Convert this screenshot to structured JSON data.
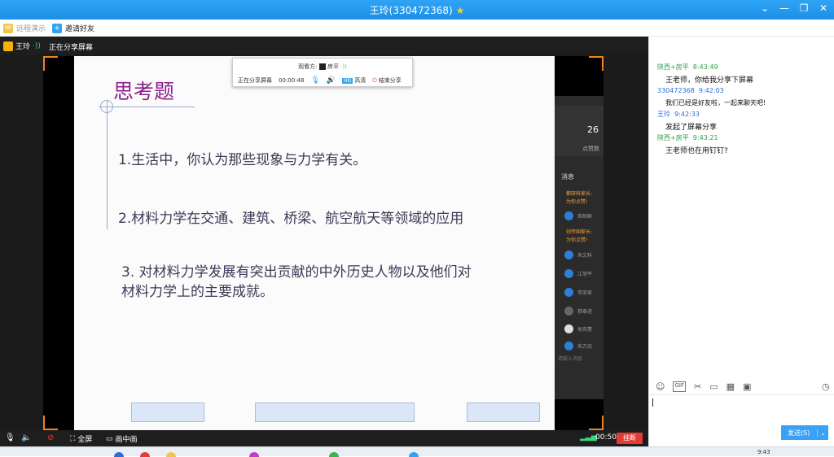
{
  "window": {
    "title": "王玲(330472368)",
    "controls": {
      "dropdown": "⌄",
      "minimize": "—",
      "restore": "❐",
      "close": "✕"
    }
  },
  "toolbar": {
    "remote_demo": "远程演示",
    "invite": "邀请好友"
  },
  "user_bar": {
    "user_name": "王玲",
    "status": "正在分享屏幕"
  },
  "share_panel": {
    "viewer_label": "观看方:",
    "viewer_name": "房平",
    "sharing_label": "正在分享屏幕",
    "timer": "00:00:48",
    "hd_badge": "HD",
    "hd_label": "高清",
    "end_label": "结束分享"
  },
  "slide": {
    "title": "思考题",
    "q1": "1.生活中，你认为那些现象与力学有关。",
    "q2": "2.材料力学在交通、建筑、桥梁、航空航天等领域的应用",
    "q3_line1": "3. 对材料力学发展有突出贡献的中外历史人物以及他们对",
    "q3_line2": "材料力学上的主要成就。"
  },
  "message_panel": {
    "count": "26",
    "count_label": "点赞数",
    "header": "消息",
    "orgs": [
      "都研科家长:",
      "为你点赞!",
      "创传国家长:",
      "为你点赞!"
    ],
    "rows": [
      "來邮群",
      "朱文科",
      "江旭平",
      "李邵家",
      "穆泰进",
      "侯奕蕙",
      "朱万武"
    ],
    "footer": "请输入消息"
  },
  "bottom_bar": {
    "fullscreen": "全屏",
    "pip": "画中画",
    "duration": "00:50",
    "hangup": "挂断"
  },
  "chat": {
    "messages": [
      {
        "sender": "陕西+房平",
        "time": "8:43:49",
        "text": "王老师，你给我分享下屏幕",
        "sender_color": "#2aa14a"
      },
      {
        "sender": "330472368",
        "time": "9:42:03",
        "text": "我们已经是好友啦，一起来聊天吧!",
        "sender_color": "#2e6bd6"
      },
      {
        "sender": "王玲",
        "time": "9:42:33",
        "text": "发起了屏幕分享",
        "sender_color": "#2e6bd6"
      },
      {
        "sender": "陕西+房平",
        "time": "9:43:21",
        "text": "王老师也在用钉钉?",
        "sender_color": "#2aa14a"
      }
    ],
    "send_label": "发送(S)"
  },
  "taskbar": {
    "time": "9:43"
  },
  "colors": {
    "accent": "#1c8fe6",
    "orange": "#f0841c",
    "hangup": "#e53b36",
    "slide_title": "#8b1f8c"
  }
}
